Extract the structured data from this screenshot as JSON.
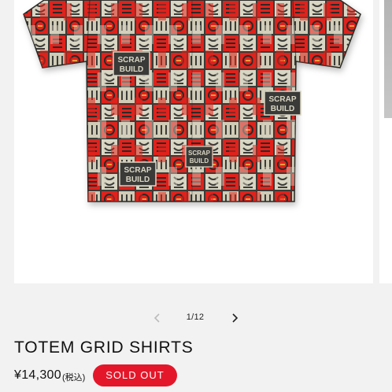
{
  "product": {
    "title": "TOTEM GRID SHIRTS",
    "price": "¥14,300",
    "tax_note": "(税込)",
    "badge": "SOLD OUT",
    "print_text_1": "SCRAP",
    "print_text_2": "BUILD"
  },
  "gallery": {
    "counter": "1/12",
    "prev_icon": "chevron-left-icon",
    "next_icon": "chevron-right-icon"
  },
  "colors": {
    "accent": "#e4172a",
    "background": "#f2f2f2",
    "pattern_red": "#e0231b",
    "pattern_dark": "#3a3a38",
    "pattern_cream": "#d9d6c4"
  }
}
